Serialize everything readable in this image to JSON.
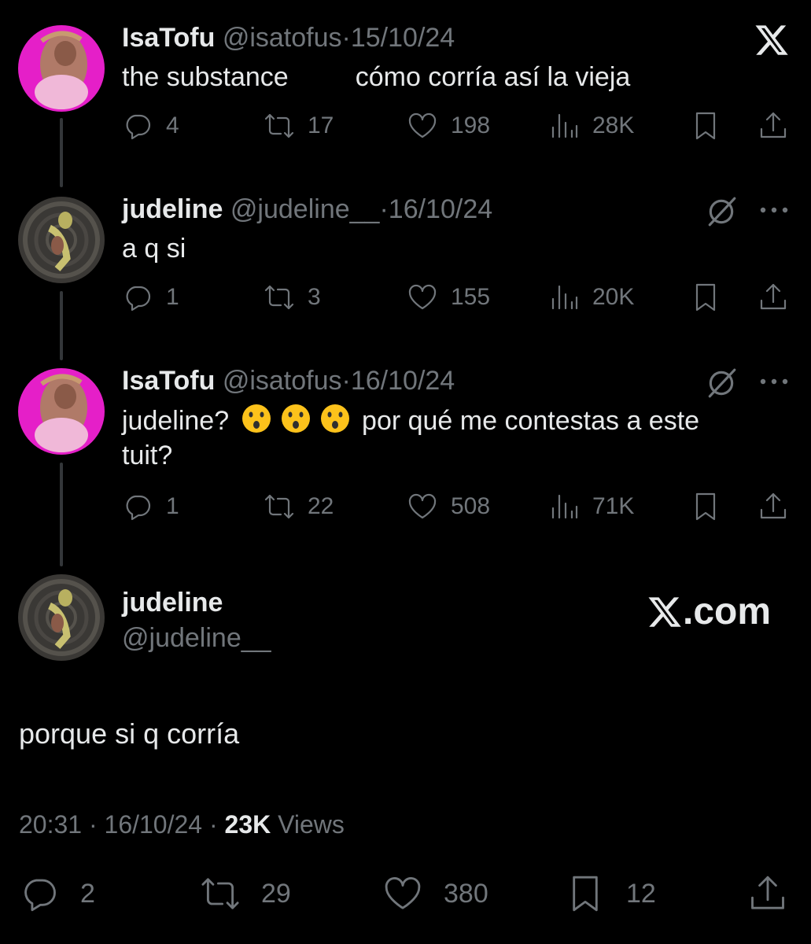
{
  "colors": {
    "background": "#000000",
    "text_primary": "#e7e9ea",
    "text_secondary": "#71767b",
    "thread_line": "#333639"
  },
  "tweets": [
    {
      "name": "IsaTofu",
      "handle": "@isatofus",
      "separator": "·",
      "date": "15/10/24",
      "text": "the substance         cómo corría así la vieja",
      "replies": "4",
      "reposts": "17",
      "likes": "198",
      "views": "28K",
      "corner_icon": "x-logo-icon"
    },
    {
      "name": "judeline",
      "handle": "@judeline__",
      "separator": "·",
      "date": "16/10/24",
      "text": "a q si",
      "replies": "1",
      "reposts": "3",
      "likes": "155",
      "views": "20K",
      "corner_icon": "grok-icon"
    },
    {
      "name": "IsaTofu",
      "handle": "@isatofus",
      "separator": "·",
      "date": "16/10/24",
      "text_before": "judeline?",
      "emojis": [
        "hushed-face-emoji",
        "hushed-face-emoji",
        "hushed-face-emoji"
      ],
      "text_after": "por qué me contestas a este",
      "text_line2": "tuit?",
      "replies": "1",
      "reposts": "22",
      "likes": "508",
      "views": "71K",
      "corner_icon": "grok-icon"
    }
  ],
  "main_tweet": {
    "name": "judeline",
    "handle": "@judeline__",
    "brand": ".com",
    "text": "porque si q corría",
    "time": "20:31",
    "separator": "·",
    "date": "16/10/24",
    "views_count": "23K",
    "views_label": "Views",
    "replies": "2",
    "reposts": "29",
    "likes": "380",
    "bookmarks": "12"
  }
}
